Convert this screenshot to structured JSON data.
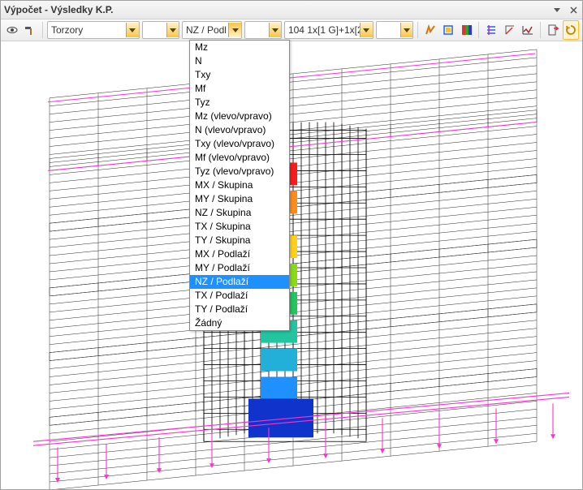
{
  "window": {
    "title": "Výpočet - Výsledky K.P."
  },
  "toolbar": {
    "combo1": {
      "value": "Torzory"
    },
    "combo2": {
      "value": ""
    },
    "combo3": {
      "value": "NZ / Podl"
    },
    "combo4": {
      "value": ""
    },
    "combo5": {
      "value": "104 1x[1 G]+1x[2"
    },
    "combo6": {
      "value": ""
    },
    "dropdown_items": [
      "Mz",
      "N",
      "Txy",
      "Mf",
      "Tyz",
      "Mz (vlevo/vpravo)",
      "N (vlevo/vpravo)",
      "Txy (vlevo/vpravo)",
      "Mf (vlevo/vpravo)",
      "Tyz (vlevo/vpravo)",
      "MX / Skupina",
      "MY / Skupina",
      "NZ / Skupina",
      "TX / Skupina",
      "TY / Skupina",
      "MX / Podlaží",
      "MY / Podlaží",
      "NZ / Podlaží",
      "TX / Podlaží",
      "TY / Podlaží",
      "Žádný"
    ],
    "dropdown_selected_index": 17
  },
  "colors": {
    "accent": "#f6c64c",
    "mesh": "#3c3c3c",
    "pink": "#ff33cc",
    "highlight": "#1e90ff"
  }
}
